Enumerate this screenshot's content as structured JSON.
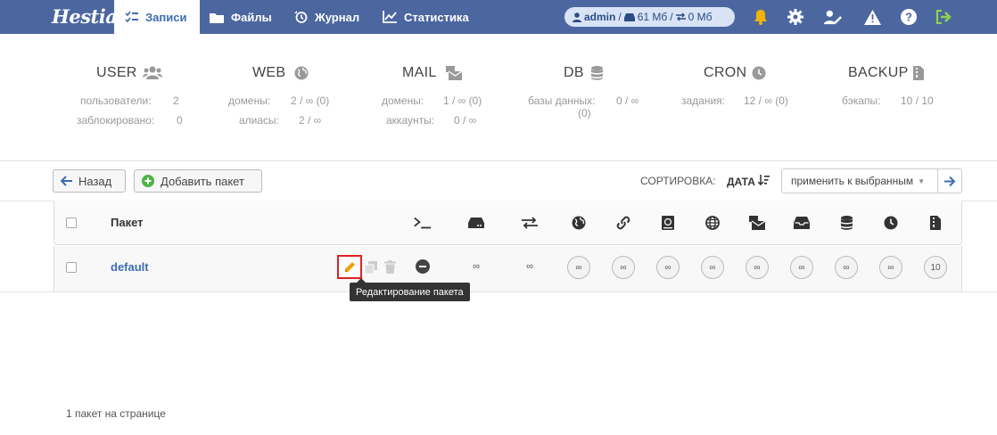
{
  "app": {
    "logo": "Hestia"
  },
  "nav": {
    "items": [
      {
        "label": "Записи",
        "icon": "list-check-icon",
        "active": true
      },
      {
        "label": "Файлы",
        "icon": "folder-icon",
        "active": false
      },
      {
        "label": "Журнал",
        "icon": "history-icon",
        "active": false
      },
      {
        "label": "Статистика",
        "icon": "chart-line-icon",
        "active": false
      }
    ],
    "user": {
      "name": "admin",
      "disk": "61 Мб",
      "bandwidth": "0 Мб",
      "sep": "/"
    }
  },
  "stats": [
    {
      "title": "USER",
      "icon": "users-icon",
      "rows": [
        {
          "label": "пользователи:",
          "value": "2"
        },
        {
          "label": "заблокировано:",
          "value": "0"
        }
      ]
    },
    {
      "title": "WEB",
      "icon": "globe-icon",
      "rows": [
        {
          "label": "домены:",
          "value": "2 / ∞ (0)"
        },
        {
          "label": "алиасы:",
          "value": "2 / ∞"
        }
      ]
    },
    {
      "title": "MAIL",
      "icon": "mail-bulk-icon",
      "rows": [
        {
          "label": "домены:",
          "value": "1 / ∞ (0)"
        },
        {
          "label": "аккаунты:",
          "value": "0 / ∞"
        }
      ]
    },
    {
      "title": "DB",
      "icon": "database-icon",
      "rows": [
        {
          "label": "базы данных:",
          "value": "0 / ∞",
          "extra": "(0)"
        }
      ]
    },
    {
      "title": "CRON",
      "icon": "clock-icon",
      "rows": [
        {
          "label": "задания:",
          "value": "12 / ∞ (0)"
        }
      ]
    },
    {
      "title": "BACKUP",
      "icon": "file-zipper-icon",
      "rows": [
        {
          "label": "бэкапы:",
          "value": "10 / 10"
        }
      ]
    }
  ],
  "toolbar": {
    "back_label": "Назад",
    "add_label": "Добавить пакет",
    "sort_label": "СОРТИРОВКА:",
    "sort_value": "ДАТА",
    "bulk_placeholder": "применить к выбранным"
  },
  "table": {
    "header_label": "Пакет",
    "columns": [
      "terminal-icon",
      "hard-drive-icon",
      "arrows-exchange-icon",
      "globe-icon",
      "link-icon",
      "book-atlas-icon",
      "world-icon",
      "mail-bulk-icon",
      "inbox-icon",
      "database-icon",
      "clock-icon",
      "file-zipper-icon"
    ],
    "rows": [
      {
        "name": "default",
        "values": [
          "∞",
          "∞",
          "∞",
          "∞",
          "∞",
          "∞",
          "∞",
          "∞",
          "∞",
          "∞",
          "10"
        ]
      }
    ],
    "tooltip": "Редактирование пакета"
  },
  "footer": {
    "count_text": "1 пакет на странице"
  },
  "colors": {
    "topbar": "#4c67a0",
    "accent": "#3d6cb0",
    "bell": "#f0b400",
    "logout": "#8fd14f",
    "edit": "#f0a000"
  }
}
